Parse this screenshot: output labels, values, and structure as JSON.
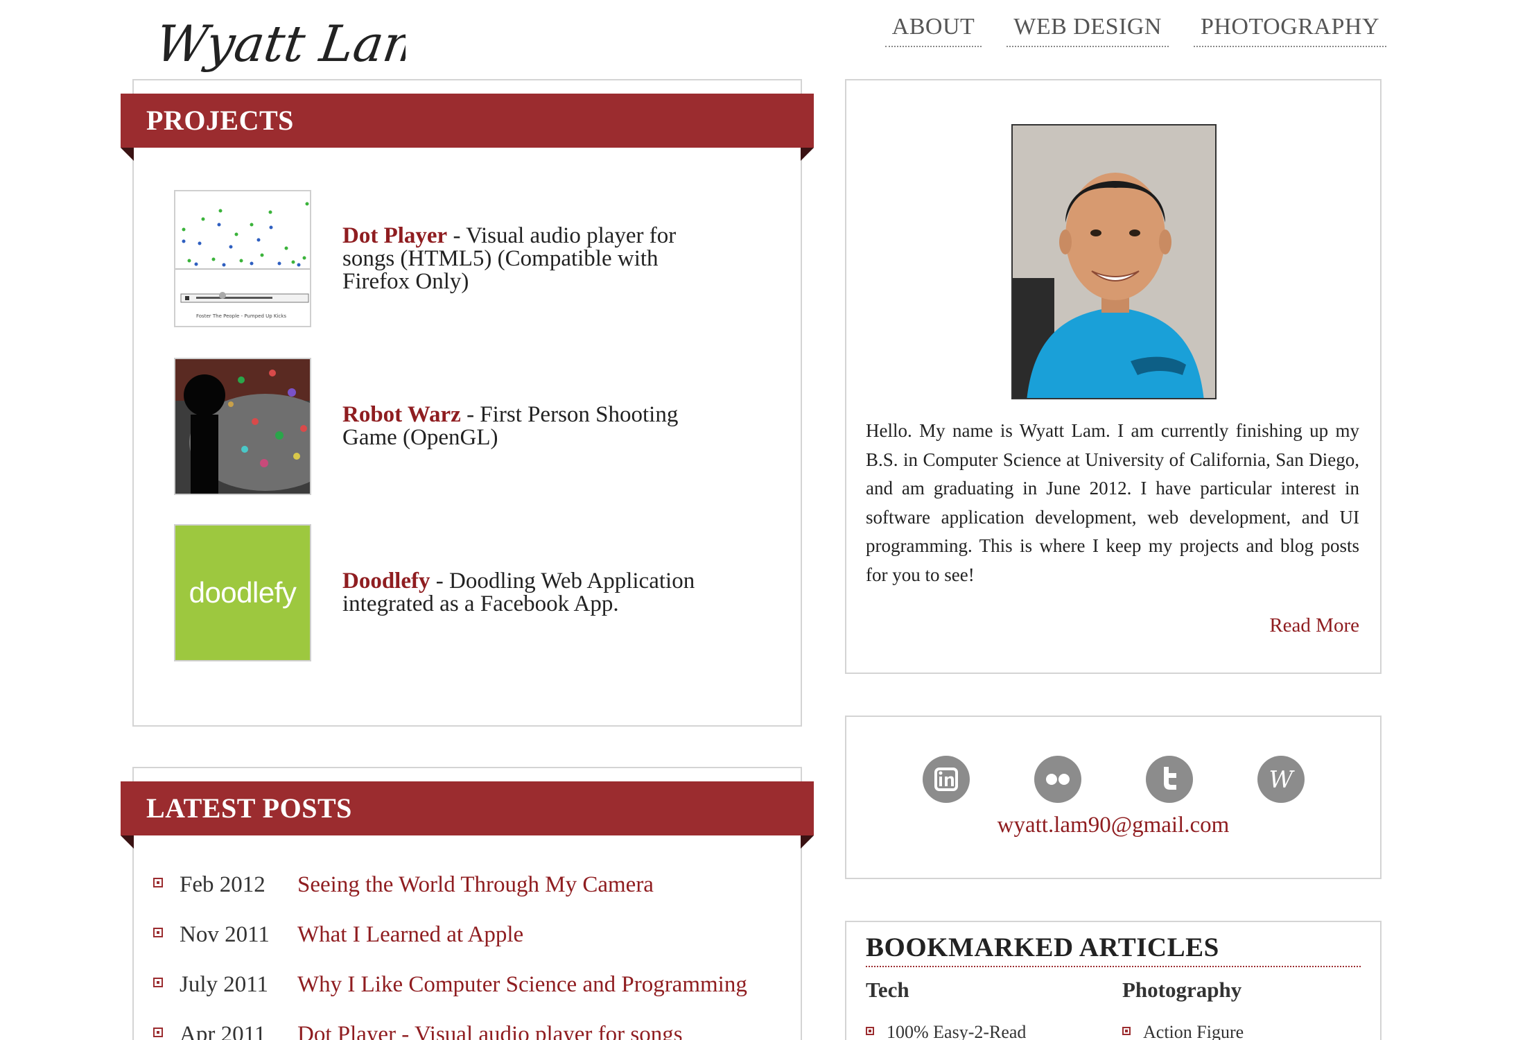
{
  "site": {
    "logo_text": "Wyatt Lam"
  },
  "nav": {
    "items": [
      {
        "label": "ABOUT"
      },
      {
        "label": "WEB DESIGN"
      },
      {
        "label": "PHOTOGRAPHY"
      }
    ]
  },
  "projects": {
    "heading": "PROJECTS",
    "items": [
      {
        "name": "Dot Player",
        "description": " - Visual audio player for songs (HTML5) (Compatible with Firefox Only)",
        "thumb_caption": "Foster The People - Pumped Up Kicks"
      },
      {
        "name": "Robot Warz",
        "description": " - First Person Shooting Game (OpenGL)"
      },
      {
        "name": "Doodlefy",
        "description": " - Doodling Web Application integrated as a Facebook App.",
        "thumb_logo": "doodlefy"
      }
    ]
  },
  "posts": {
    "heading": "LATEST POSTS",
    "items": [
      {
        "date": "Feb 2012",
        "title": "Seeing the World Through My Camera"
      },
      {
        "date": "Nov 2011",
        "title": "What I Learned at Apple"
      },
      {
        "date": "July 2011",
        "title": "Why I Like Computer Science and Programming"
      },
      {
        "date": "Apr 2011",
        "title": "Dot Player - Visual audio player for songs"
      }
    ]
  },
  "about": {
    "bio": "Hello. My name is Wyatt Lam. I am currently finishing up my B.S. in Computer Science at University of California, San Diego, and am graduating in June 2012. I have particular interest in software application development, web development, and UI programming. This is where I keep my projects and blog posts for you to see!",
    "read_more": "Read More"
  },
  "social": {
    "icons": [
      "linkedin-icon",
      "flickr-icon",
      "twitter-icon",
      "wordpress-icon"
    ],
    "email": "wyatt.lam90@gmail.com"
  },
  "bookmarks": {
    "heading": "BOOKMARKED ARTICLES",
    "columns": [
      {
        "title": "Tech",
        "items": [
          "100% Easy-2-Read"
        ]
      },
      {
        "title": "Photography",
        "items": [
          "Action Figure"
        ]
      }
    ]
  },
  "colors": {
    "accent": "#9b2c2f",
    "link": "#8f1d20",
    "icon_gray": "#8c8c8c",
    "doodlefy_green": "#9dc83f"
  }
}
